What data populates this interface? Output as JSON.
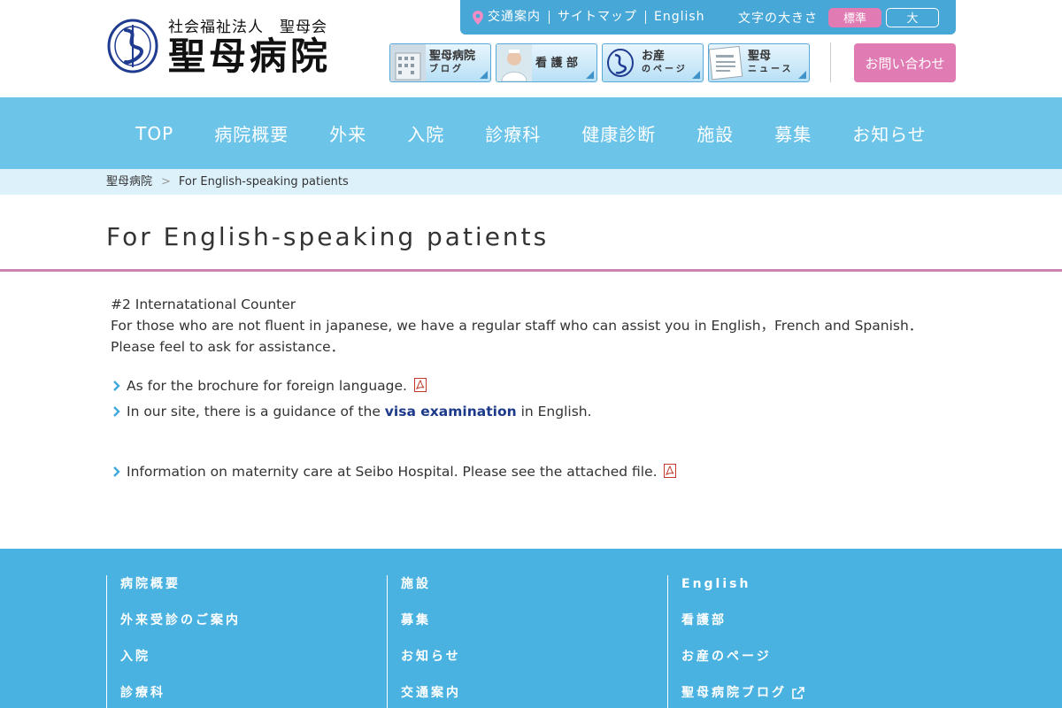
{
  "header": {
    "logo_sub": "社会福祉法人　聖母会",
    "logo_main": "聖母病院",
    "topbar_links": [
      "交通案内",
      "サイトマップ",
      "English"
    ],
    "fontsize_label": "文字の大きさ",
    "fontsize_standard": "標準",
    "fontsize_large": "大",
    "banners": [
      {
        "title": "聖母病院",
        "sub": "ブログ"
      },
      {
        "title": "看 護 部",
        "sub": ""
      },
      {
        "title": "お産",
        "sub": "のページ"
      },
      {
        "title": "聖母",
        "sub": "ニュース"
      }
    ],
    "contact": "お問い合わせ"
  },
  "nav": [
    "TOP",
    "病院概要",
    "外来",
    "入院",
    "診療科",
    "健康診断",
    "施設",
    "募集",
    "お知らせ"
  ],
  "breadcrumb": {
    "home": "聖母病院",
    "sep": ">",
    "current": "For English-speaking patients"
  },
  "page_title": "For English-speaking patients",
  "content": {
    "line1": "#2 Internatational Counter",
    "line2": "For those who are not fluent in japanese, we have a regular staff who can assist you in English，French and Spanish．  Please feel to ask for assistance．",
    "item1": "As for the brochure for foreign language.",
    "item2_pre": "In our site, there is a guidance of the ",
    "item2_link": "visa examination",
    "item2_post": " in English.",
    "item3": "Information on maternity care at Seibo Hospital. Please see the attached file."
  },
  "footer": {
    "col1": [
      "病院概要",
      "外来受診のご案内",
      "入院",
      "診療科"
    ],
    "col2": [
      "施設",
      "募集",
      "お知らせ",
      "交通案内"
    ],
    "col3": [
      "English",
      "看護部",
      "お産のページ",
      "聖母病院ブログ"
    ]
  },
  "colors": {
    "topbar": "#47a7d6",
    "nav": "#6cc4e9",
    "accent_pink": "#e07cb3",
    "footer": "#4ab2e0"
  }
}
